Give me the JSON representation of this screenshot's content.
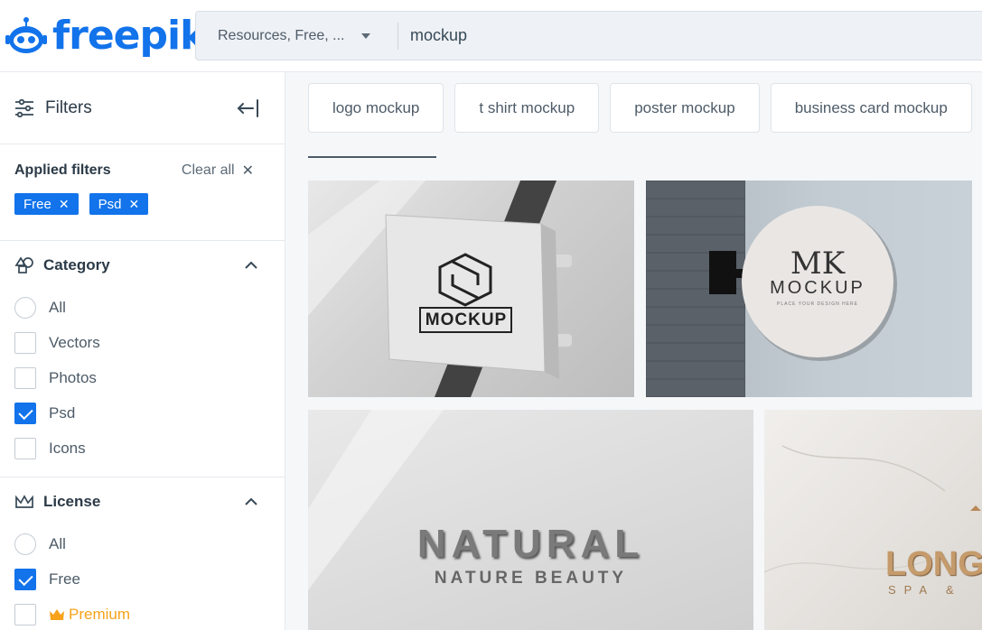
{
  "brand": {
    "name": "freepik",
    "color": "#1273eb"
  },
  "search": {
    "resource_filter": "Resources, Free, ...",
    "query": "mockup"
  },
  "sidebar": {
    "title": "Filters",
    "applied": {
      "label": "Applied filters",
      "clear_all": "Clear all",
      "chips": [
        "Free",
        "Psd"
      ]
    },
    "category": {
      "title": "Category",
      "options": [
        {
          "label": "All",
          "type": "radio",
          "checked": false
        },
        {
          "label": "Vectors",
          "type": "checkbox",
          "checked": false
        },
        {
          "label": "Photos",
          "type": "checkbox",
          "checked": false
        },
        {
          "label": "Psd",
          "type": "checkbox",
          "checked": true
        },
        {
          "label": "Icons",
          "type": "checkbox",
          "checked": false
        }
      ]
    },
    "license": {
      "title": "License",
      "options": [
        {
          "label": "All",
          "type": "radio",
          "checked": false
        },
        {
          "label": "Free",
          "type": "checkbox",
          "checked": true
        },
        {
          "label": "Premium",
          "type": "checkbox",
          "checked": false
        }
      ]
    }
  },
  "tags": [
    "logo mockup",
    "t shirt mockup",
    "poster mockup",
    "business card mockup"
  ],
  "results": [
    {
      "alt_text": "MOCKUP"
    },
    {
      "line1": "MK",
      "line2": "MOCKUP",
      "line3": "PLACE YOUR DESIGN HERE"
    },
    {
      "line1": "NATURAL",
      "line2": "NATURE BEAUTY"
    },
    {
      "line1": "LONG",
      "line2": "SPA &"
    }
  ]
}
